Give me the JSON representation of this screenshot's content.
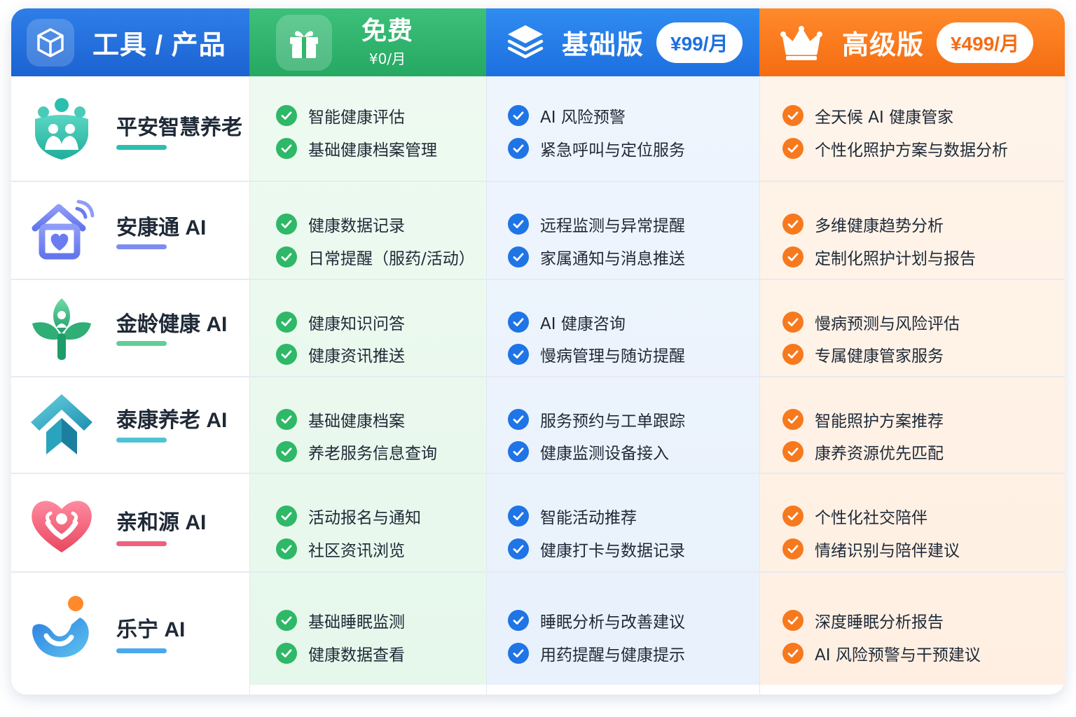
{
  "header": {
    "tool_col": "工具 / 产品",
    "free": {
      "title": "免费",
      "price": "¥0/月"
    },
    "basic": {
      "title": "基础版",
      "price": "¥99/月"
    },
    "pro": {
      "title": "高级版",
      "price": "¥499/月"
    }
  },
  "colors": {
    "free": "#2eb867",
    "basic": "#1f74e6",
    "pro": "#f7791e",
    "tool_header": "#1b63d2"
  },
  "rows": [
    {
      "name": "平安智慧养老",
      "icon": "family-shield-icon",
      "accent": "#2bbfae",
      "free": [
        "智能健康评估",
        "基础健康档案管理"
      ],
      "basic": [
        "AI 风险预警",
        "紧急呼叫与定位服务"
      ],
      "pro": [
        "全天候 AI 健康管家",
        "个性化照护方案与数据分析"
      ]
    },
    {
      "name": "安康通 AI",
      "icon": "smart-home-heart-icon",
      "accent": "#7e8cf2",
      "free": [
        "健康数据记录",
        "日常提醒（服药/活动）"
      ],
      "basic": [
        "远程监测与异常提醒",
        "家属通知与消息推送"
      ],
      "pro": [
        "多维健康趋势分析",
        "定制化照护计划与报告"
      ]
    },
    {
      "name": "金龄健康 AI",
      "icon": "sprout-person-icon",
      "accent": "#5fcf98",
      "free": [
        "健康知识问答",
        "健康资讯推送"
      ],
      "basic": [
        "AI 健康咨询",
        "慢病管理与随访提醒"
      ],
      "pro": [
        "慢病预测与风险评估",
        "专属健康管家服务"
      ]
    },
    {
      "name": "泰康养老 AI",
      "icon": "house-arrow-icon",
      "accent": "#50c2d4",
      "free": [
        "基础健康档案",
        "养老服务信息查询"
      ],
      "basic": [
        "服务预约与工单跟踪",
        "健康监测设备接入"
      ],
      "pro": [
        "智能照护方案推荐",
        "康养资源优先匹配"
      ]
    },
    {
      "name": "亲和源 AI",
      "icon": "heart-hands-icon",
      "accent": "#f0607c",
      "free": [
        "活动报名与通知",
        "社区资讯浏览"
      ],
      "basic": [
        "智能活动推荐",
        "健康打卡与数据记录"
      ],
      "pro": [
        "个性化社交陪伴",
        "情绪识别与陪伴建议"
      ]
    },
    {
      "name": "乐宁 AI",
      "icon": "person-wave-icon",
      "accent": "#4aa8ec",
      "free": [
        "基础睡眠监测",
        "健康数据查看"
      ],
      "basic": [
        "睡眠分析与改善建议",
        "用药提醒与健康提示"
      ],
      "pro": [
        "深度睡眠分析报告",
        "AI 风险预警与干预建议"
      ]
    }
  ]
}
